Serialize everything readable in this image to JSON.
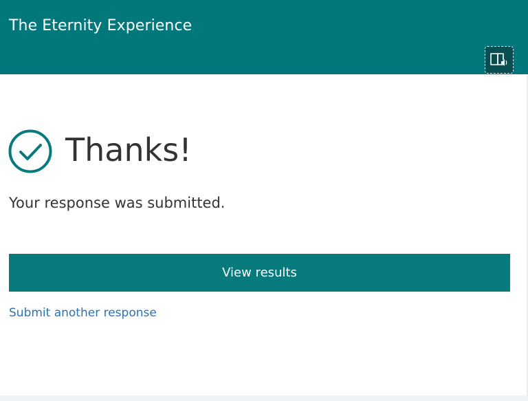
{
  "header": {
    "title": "The Eternity Experience",
    "background_color": "#03787c",
    "reader_button": {
      "icon": "immersive-reader-icon"
    }
  },
  "confirmation": {
    "icon": "checkmark-circle-icon",
    "icon_color": "#077a7d",
    "heading": "Thanks!",
    "message": "Your response was submitted."
  },
  "actions": {
    "view_results_label": "View results",
    "view_results_color": "#077a7d",
    "submit_another_label": "Submit another response",
    "link_color": "#2a73b5"
  }
}
